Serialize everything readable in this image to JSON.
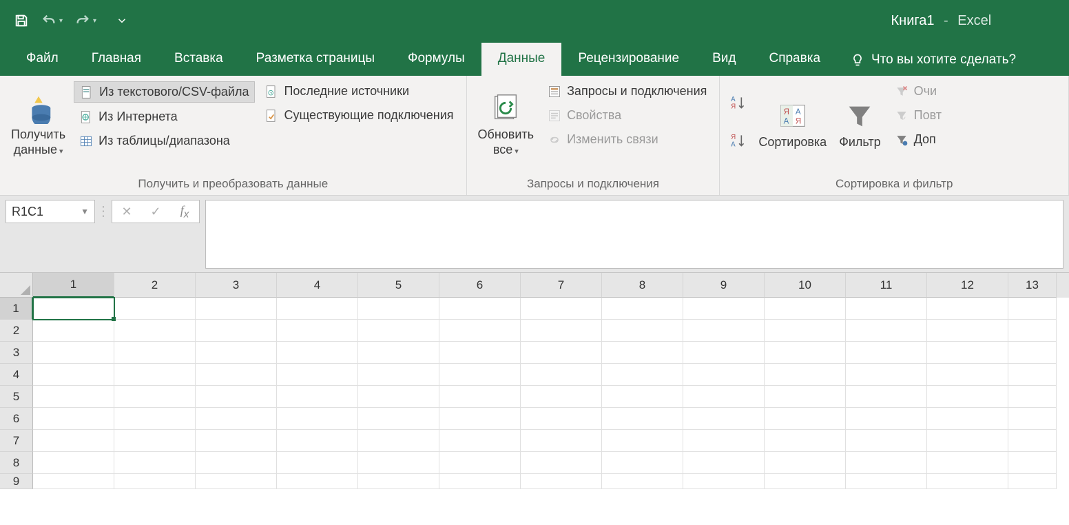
{
  "titlebar": {
    "document": "Книга1",
    "separator": "-",
    "app": "Excel"
  },
  "tabs": {
    "items": [
      "Файл",
      "Главная",
      "Вставка",
      "Разметка страницы",
      "Формулы",
      "Данные",
      "Рецензирование",
      "Вид",
      "Справка"
    ],
    "active_index": 5,
    "tell_me": "Что вы хотите сделать?"
  },
  "ribbon": {
    "group1": {
      "label": "Получить и преобразовать данные",
      "get_data": "Получить\nданные",
      "from_csv": "Из текстового/CSV-файла",
      "from_web": "Из Интернета",
      "from_table": "Из таблицы/диапазона",
      "recent": "Последние источники",
      "existing": "Существующие подключения"
    },
    "group2": {
      "label": "Запросы и подключения",
      "refresh_all": "Обновить\nвсе",
      "queries": "Запросы и подключения",
      "properties": "Свойства",
      "edit_links": "Изменить связи"
    },
    "group3": {
      "label": "Сортировка и фильтр",
      "sort": "Сортировка",
      "filter": "Фильтр",
      "clear": "Очи",
      "reapply": "Повт",
      "advanced": "Доп"
    }
  },
  "formula_bar": {
    "name_box": "R1C1"
  },
  "grid": {
    "columns": [
      "1",
      "2",
      "3",
      "4",
      "5",
      "6",
      "7",
      "8",
      "9",
      "10",
      "11",
      "12",
      "13"
    ],
    "rows": [
      "1",
      "2",
      "3",
      "4",
      "5",
      "6",
      "7",
      "8",
      "9"
    ],
    "selected_col": 0,
    "selected_row": 0
  }
}
